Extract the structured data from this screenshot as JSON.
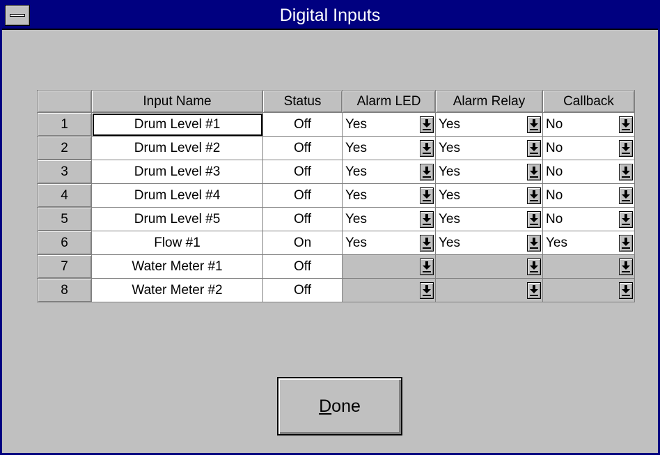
{
  "window": {
    "title": "Digital Inputs"
  },
  "table": {
    "headers": [
      "",
      "Input Name",
      "Status",
      "Alarm LED",
      "Alarm Relay",
      "Callback"
    ],
    "rows": [
      {
        "num": "1",
        "name": "Drum Level #1",
        "status": "Off",
        "alarm_led": "Yes",
        "alarm_relay": "Yes",
        "callback": "No"
      },
      {
        "num": "2",
        "name": "Drum Level #2",
        "status": "Off",
        "alarm_led": "Yes",
        "alarm_relay": "Yes",
        "callback": "No"
      },
      {
        "num": "3",
        "name": "Drum Level #3",
        "status": "Off",
        "alarm_led": "Yes",
        "alarm_relay": "Yes",
        "callback": "No"
      },
      {
        "num": "4",
        "name": "Drum Level #4",
        "status": "Off",
        "alarm_led": "Yes",
        "alarm_relay": "Yes",
        "callback": "No"
      },
      {
        "num": "5",
        "name": "Drum Level #5",
        "status": "Off",
        "alarm_led": "Yes",
        "alarm_relay": "Yes",
        "callback": "No"
      },
      {
        "num": "6",
        "name": "Flow #1",
        "status": "On",
        "alarm_led": "Yes",
        "alarm_relay": "Yes",
        "callback": "Yes"
      },
      {
        "num": "7",
        "name": "Water Meter #1",
        "status": "Off",
        "alarm_led": "",
        "alarm_relay": "",
        "callback": ""
      },
      {
        "num": "8",
        "name": "Water Meter #2",
        "status": "Off",
        "alarm_led": "",
        "alarm_relay": "",
        "callback": ""
      }
    ]
  },
  "buttons": {
    "done_mnemonic": "D",
    "done_rest": "one"
  },
  "icons": {
    "system_menu": "system-menu-icon",
    "dropdown": "down-arrow-icon"
  },
  "colors": {
    "title_bar": "#000080",
    "face": "#c0c0c0",
    "cell": "#ffffff"
  }
}
